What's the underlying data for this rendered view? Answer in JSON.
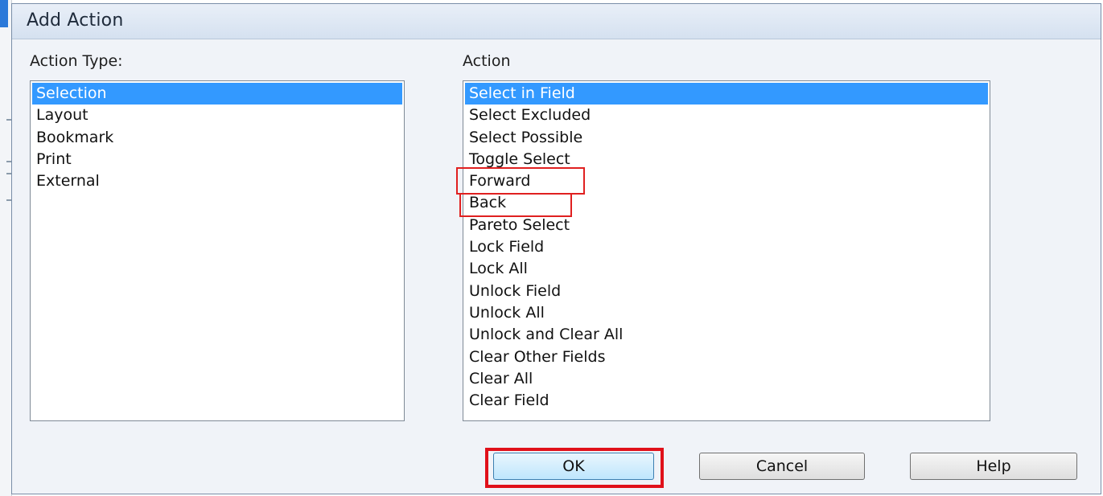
{
  "dialog": {
    "title": "Add Action"
  },
  "action_type": {
    "label": "Action Type:",
    "items": [
      "Selection",
      "Layout",
      "Bookmark",
      "Print",
      "External"
    ],
    "selected": "Selection"
  },
  "action": {
    "label": "Action",
    "items": [
      "Select in Field",
      "Select Excluded",
      "Select Possible",
      "Toggle Select",
      "Forward",
      "Back",
      "Pareto Select",
      "Lock Field",
      "Lock All",
      "Unlock Field",
      "Unlock All",
      "Unlock and Clear All",
      "Clear Other Fields",
      "Clear All",
      "Clear Field"
    ],
    "selected": "Select in Field"
  },
  "buttons": {
    "ok": "OK",
    "cancel": "Cancel",
    "help": "Help"
  },
  "colors": {
    "selection": "#3399ff",
    "highlight_annotation": "#e02020"
  }
}
